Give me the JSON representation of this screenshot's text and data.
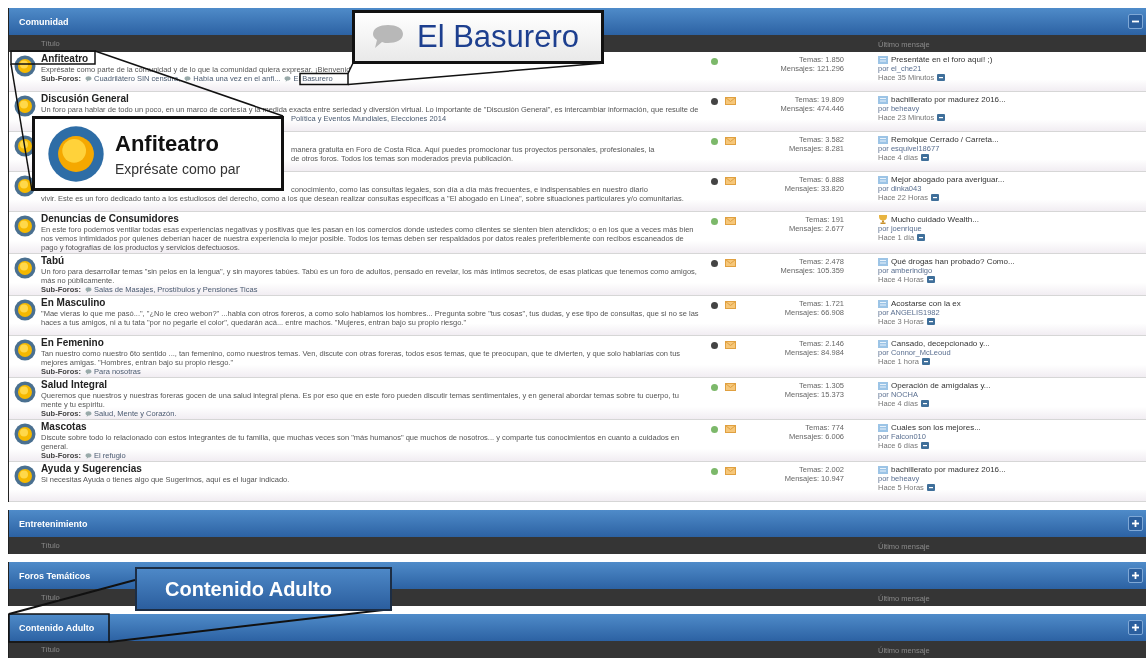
{
  "sections": [
    {
      "title": "Comunidad",
      "expanded": true,
      "columns": [
        "Título",
        "Último mensaje"
      ],
      "forums": [
        {
          "title": "Anfiteatro",
          "description": "Exprésate como parte de la comunidad y de lo que la comunidad quiera expresar. ¡Bienvenid",
          "subforums_label": "Sub-Foros:",
          "subforums": [
            "Cuadrilátero SIN censura,",
            "Había una vez en el anfi...",
            "El Basurero"
          ],
          "color": "#7cb86a",
          "envelope": false,
          "topics": "Temas: 1.850",
          "posts": "Mensajes: 121.296",
          "last": {
            "kind": "post",
            "title": "Presentáte en el foro aquí! ;)",
            "author": "por el_che21",
            "time": "Hace 35 Minutos"
          }
        },
        {
          "title": "Discusión General",
          "description": "Un foro para hablar de todo un poco, en un marco de cortesía y la medida exacta entre seriedad y diversión virtual. Lo importante de \"Discusión General\", es intercambiar información, que resulte de",
          "tail_lines": [
            "Política y Eventos Mundiales, Elecciones 2014"
          ],
          "color": "#444444",
          "envelope": true,
          "topics": "Temas: 19.809",
          "posts": "Mensajes: 474.446",
          "last": {
            "kind": "post",
            "title": "bachillerato por madurez 2016...",
            "author": "por beheavy",
            "time": "Hace 23 Minutos"
          }
        },
        {
          "partial_lines": [
            "manera gratuita en Foro de Costa Rica. Aquí puedes promocionar tus proyectos personales, profesionales, la",
            "de otros foros. Todos los temas son moderados previa publicación."
          ],
          "color": "#7cb86a",
          "envelope": true,
          "topics": "Temas: 3.582",
          "posts": "Mensajes: 8.281",
          "last": {
            "kind": "post",
            "title": "Remolque Cerrado / Carreta...",
            "author": "por esquivel18677",
            "time": "Hace 4 días"
          }
        },
        {
          "partial_lines": [
            "conocimiento, como las consultas legales, son día a día más frecuentes, e indispensables en nuestro diario"
          ],
          "description": "vivir. Este es un foro dedicado tanto a los estudiosos del derecho, como a los que desean realizar consultas específicas a \"El abogado en Línea\", sobre situaciones particulares y/o comunitarias.",
          "color": "#444444",
          "envelope": true,
          "topics": "Temas: 6.888",
          "posts": "Mensajes: 33.820",
          "last": {
            "kind": "post",
            "title": "Mejor abogado para averiguar...",
            "author": "por dinka043",
            "time": "Hace 22 Horas"
          }
        },
        {
          "title": "Denuncias de Consumidores",
          "description": "En este foro podemos ventilar todas esas experiencias negativas y positivas que les pasan en los comercios donde ustedes como clientes se sienten bien atendidos; o en los que a veces más bien nos vemos intimidados por quienes deberían hacer de nuestra experiencia lo mejor posible. Todos los temas deben ser respaldados por datos reales preferiblemente con recibos escaneados de pago y fotografías de los productos y servicios defectuosos.",
          "color": "#7cb86a",
          "envelope": true,
          "topics": "Temas: 191",
          "posts": "Mensajes: 2.677",
          "last": {
            "kind": "award",
            "title": "Mucho cuidado Wealth...",
            "author": "por joenrique",
            "time": "Hace 1 día"
          }
        },
        {
          "title": "Tabú",
          "description": "Un foro para desarrollar temas \"sin pelos en la lengua\", y sin mayores tabúes. Tabú es un foro de adultos, pensado en revelar, los más íntimos secretos, de esas platicas que tenemos como amigos, más no públicamente.",
          "subforums_label": "Sub-Foros:",
          "subforums": [
            "Salas de Masajes, Prostíbulos y Pensiones Ticas"
          ],
          "color": "#444444",
          "envelope": true,
          "topics": "Temas: 2.478",
          "posts": "Mensajes: 105.359",
          "last": {
            "kind": "post",
            "title": "Qué drogas han probado? Como...",
            "author": "por amberindigo",
            "time": "Hace 4 Horas"
          }
        },
        {
          "title": "En Masculino",
          "description": "\"Mae vieras lo que me pasó...\", \"¿No le creo webon?\" ...habla con otros foreros, a como solo hablamos los hombres... Pregunta sobre \"tus cosas\", tus dudas, y ese tipo de consultas, que si no se las haces a tus amigos, ni a tu tata \"por no pegarle el color\", quedarán acá... entre machos. \"Mujeres, entran bajo su propio riesgo.\"",
          "color": "#444444",
          "envelope": true,
          "topics": "Temas: 1.721",
          "posts": "Mensajes: 66.908",
          "last": {
            "kind": "post",
            "title": "Acostarse con la ex",
            "author": "por ANGELIS1982",
            "time": "Hace 3 Horas"
          }
        },
        {
          "title": "En Femenino",
          "description": "Tan nuestro como nuestro 6to sentido ..., tan femenino, como nuestros temas. Ven, discute con otras foreras, todos esos temas, que te preocupan, que te divierten, y que solo hablarías con tus mejores amigas. \"Hombres, entran bajo su propio riesgo.\"",
          "subforums_label": "Sub-Foros:",
          "subforums": [
            "Para nosotras"
          ],
          "color": "#444444",
          "envelope": true,
          "topics": "Temas: 2.146",
          "posts": "Mensajes: 84.984",
          "last": {
            "kind": "post",
            "title": "Cansado, decepcionado y...",
            "author": "por Connor_McLeoud",
            "time": "Hace 1 hora"
          }
        },
        {
          "title": "Salud Integral",
          "description": "Queremos que nuestros y nuestras foreras gocen de una salud integral plena. Es por eso que en este foro pueden discutir temas sentimentales, y en general abordar temas sobre tu cuerpo, tu mente y tu espíritu.",
          "subforums_label": "Sub-Foros:",
          "subforums": [
            "Salud, Mente y Corazón."
          ],
          "color": "#7cb86a",
          "envelope": true,
          "topics": "Temas: 1.305",
          "posts": "Mensajes: 15.373",
          "last": {
            "kind": "post",
            "title": "Operación de amígdalas y...",
            "author": "por NOCHA",
            "time": "Hace 4 días"
          }
        },
        {
          "title": "Mascotas",
          "description": "Discute sobre todo lo relacionado con estos integrantes de tu familia, que muchas veces son \"más humanos\" que muchos de nosotros... y comparte tus conocimientos en cuanto a cuidados en general.",
          "subforums_label": "Sub-Foros:",
          "subforums": [
            "El refugio"
          ],
          "color": "#7cb86a",
          "envelope": true,
          "topics": "Temas: 774",
          "posts": "Mensajes: 6.006",
          "last": {
            "kind": "post",
            "title": "Cuales son los mejores...",
            "author": "por Falcon010",
            "time": "Hace 6 días"
          }
        },
        {
          "title": "Ayuda y Sugerencias",
          "description": "Si necesitas Ayuda o tienes algo que Sugerirnos, aquí es el lugar indicado.",
          "color": "#7cb86a",
          "envelope": true,
          "topics": "Temas: 2.002",
          "posts": "Mensajes: 10.947",
          "last": {
            "kind": "post",
            "title": "bachillerato por madurez 2016...",
            "author": "por beheavy",
            "time": "Hace 5 Horas"
          }
        }
      ]
    },
    {
      "title": "Entretenimiento",
      "expanded": false,
      "columns": [
        "Título",
        "Último mensaje"
      ]
    },
    {
      "title": "Foros Temáticos",
      "expanded": false,
      "columns": [
        "Título",
        "Último mensaje"
      ]
    },
    {
      "title": "Contenido Adulto",
      "expanded": false,
      "columns": [
        "Título",
        "Último mensaje"
      ]
    }
  ],
  "callouts": [
    {
      "kind": "subforum",
      "title": "El Basurero"
    },
    {
      "kind": "forum",
      "title": "Anfiteatro",
      "subtitle": "Exprésate como par"
    },
    {
      "kind": "section",
      "title": "Contenido Adulto"
    }
  ]
}
